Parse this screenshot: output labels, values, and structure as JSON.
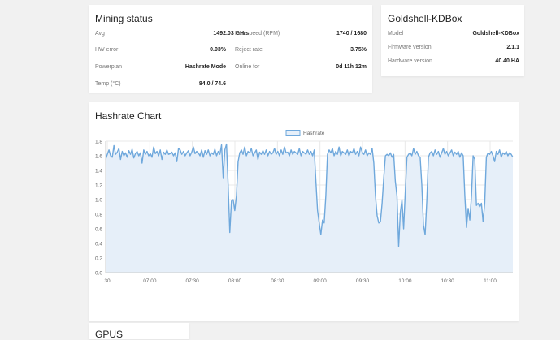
{
  "mining": {
    "title": "Mining status",
    "left": [
      {
        "label": "Avg",
        "value": "1492.03 GH/s"
      },
      {
        "label": "HW error",
        "value": "0.03%"
      },
      {
        "label": "Powerplan",
        "value": "Hashrate Mode"
      },
      {
        "label": "Temp (°C)",
        "value": "84.0 / 74.6"
      }
    ],
    "right": [
      {
        "label": "Fan speed (RPM)",
        "value": "1740 / 1680"
      },
      {
        "label": "Reject rate",
        "value": "3.75%"
      },
      {
        "label": "Online for",
        "value": "0d 11h 12m"
      }
    ]
  },
  "device": {
    "title": "Goldshell-KDBox",
    "rows": [
      {
        "label": "Model",
        "value": "Goldshell-KDBox"
      },
      {
        "label": "Firmware version",
        "value": "2.1.1"
      },
      {
        "label": "Hardware version",
        "value": "40.40.HA"
      }
    ]
  },
  "chart_card": {
    "title": "Hashrate Chart"
  },
  "gpu_card": {
    "title": "GPUS"
  },
  "colors": {
    "line": "#6fa8dc",
    "fill": "#e6eff9",
    "grid": "#e8e8e8"
  },
  "chart_data": {
    "type": "area",
    "legend": {
      "label": "Hashrate",
      "placement": "top-center"
    },
    "ylim": [
      0,
      1.8
    ],
    "yticks": [
      "0.0",
      "0.2",
      "0.4",
      "0.6",
      "0.8",
      "1.0",
      "1.2",
      "1.4",
      "1.6",
      "1.8"
    ],
    "xticks": [
      "30",
      "07:00",
      "07:30",
      "08:00",
      "08:30",
      "09:00",
      "09:30",
      "10:00",
      "10:30",
      "11:00"
    ],
    "grid": true,
    "series": [
      {
        "name": "Hashrate",
        "values": [
          1.55,
          1.62,
          1.68,
          1.6,
          1.58,
          1.74,
          1.62,
          1.65,
          1.7,
          1.55,
          1.66,
          1.6,
          1.64,
          1.58,
          1.67,
          1.62,
          1.69,
          1.57,
          1.63,
          1.66,
          1.6,
          1.64,
          1.5,
          1.68,
          1.62,
          1.66,
          1.6,
          1.63,
          1.58,
          1.72,
          1.63,
          1.66,
          1.6,
          1.68,
          1.55,
          1.65,
          1.62,
          1.68,
          1.62,
          1.63,
          1.65,
          1.6,
          1.64,
          1.52,
          1.7,
          1.68,
          1.62,
          1.66,
          1.6,
          1.64,
          1.67,
          1.6,
          1.65,
          1.72,
          1.63,
          1.66,
          1.64,
          1.6,
          1.68,
          1.58,
          1.67,
          1.62,
          1.68,
          1.6,
          1.64,
          1.62,
          1.69,
          1.6,
          1.66,
          1.62,
          1.75,
          1.3,
          1.68,
          1.76,
          1.2,
          0.55,
          0.98,
          1.0,
          0.85,
          1.05,
          1.52,
          1.64,
          1.68,
          1.62,
          1.72,
          1.6,
          1.66,
          1.64,
          1.7,
          1.6,
          1.64,
          1.68,
          1.55,
          1.65,
          1.62,
          1.67,
          1.62,
          1.68,
          1.6,
          1.66,
          1.62,
          1.64,
          1.7,
          1.62,
          1.66,
          1.6,
          1.68,
          1.62,
          1.72,
          1.64,
          1.65,
          1.6,
          1.68,
          1.62,
          1.66,
          1.64,
          1.62,
          1.7,
          1.6,
          1.66,
          1.64,
          1.62,
          1.68,
          1.62,
          1.66,
          1.6,
          1.68,
          1.25,
          0.85,
          0.68,
          0.52,
          0.72,
          0.68,
          1.05,
          1.62,
          1.68,
          1.64,
          1.7,
          1.6,
          1.66,
          1.62,
          1.72,
          1.6,
          1.66,
          1.64,
          1.62,
          1.68,
          1.6,
          1.66,
          1.64,
          1.7,
          1.62,
          1.66,
          1.6,
          1.72,
          1.65,
          1.62,
          1.68,
          1.6,
          1.64,
          1.62,
          1.7,
          1.5,
          1.05,
          0.78,
          0.68,
          0.7,
          0.95,
          1.3,
          1.6,
          1.62,
          1.6,
          1.64,
          1.58,
          1.62,
          1.25,
          1.05,
          0.36,
          0.82,
          1.0,
          0.6,
          1.1,
          1.58,
          1.62,
          1.64,
          1.6,
          1.7,
          1.62,
          1.66,
          1.6,
          1.58,
          1.2,
          0.65,
          0.52,
          0.98,
          1.58,
          1.64,
          1.66,
          1.6,
          1.68,
          1.62,
          1.66,
          1.58,
          1.64,
          1.7,
          1.62,
          1.66,
          1.6,
          1.64,
          1.68,
          1.6,
          1.65,
          1.62,
          1.66,
          1.58,
          1.64,
          1.6,
          1.05,
          0.62,
          0.88,
          0.72,
          1.05,
          1.6,
          1.55,
          0.92,
          0.95,
          0.9,
          0.95,
          0.7,
          0.95,
          1.58,
          1.64,
          1.62,
          1.66,
          1.6,
          1.52,
          1.66,
          1.62,
          1.68,
          1.58,
          1.64,
          1.62,
          1.66,
          1.6,
          1.64,
          1.62,
          1.58
        ]
      }
    ]
  }
}
